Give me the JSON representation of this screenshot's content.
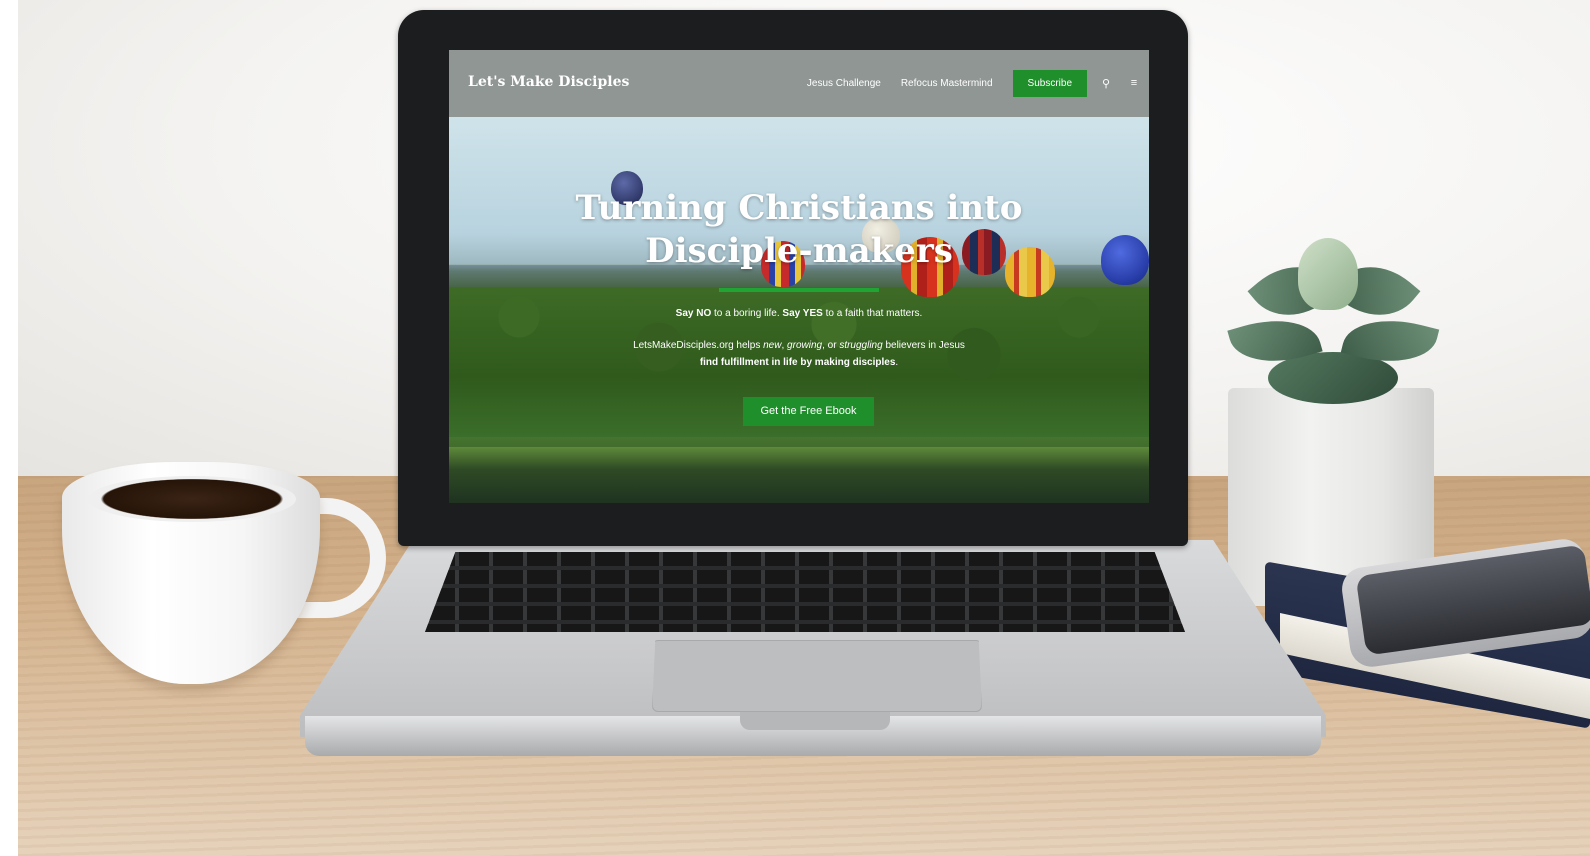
{
  "site": {
    "logo": "Let's Make Disciples",
    "nav": {
      "links": [
        "Jesus Challenge",
        "Refocus Mastermind"
      ],
      "subscribe_label": "Subscribe",
      "search_icon": "⚲",
      "menu_icon": "≡"
    },
    "hero": {
      "title_line1": "Turning Christians into",
      "title_line2": "Disciple-makers",
      "tagline_pre": "Say NO",
      "tagline_mid": " to a boring life. ",
      "tagline_strong2": "Say YES",
      "tagline_post": " to a faith that matters.",
      "desc_part1": "LetsMakeDisciples.org helps ",
      "desc_em1": "new",
      "desc_sep1": ", ",
      "desc_em2": "growing",
      "desc_sep2": ", or ",
      "desc_em3": "struggling",
      "desc_part2": " believers in Jesus",
      "desc_strong": "find fulfillment in life by making disciples",
      "desc_end": ".",
      "cta_label": "Get the Free Ebook"
    }
  },
  "colors": {
    "header_bg": "#8f9693",
    "accent_green": "#1f8f2b",
    "divider_green": "#20a534"
  }
}
